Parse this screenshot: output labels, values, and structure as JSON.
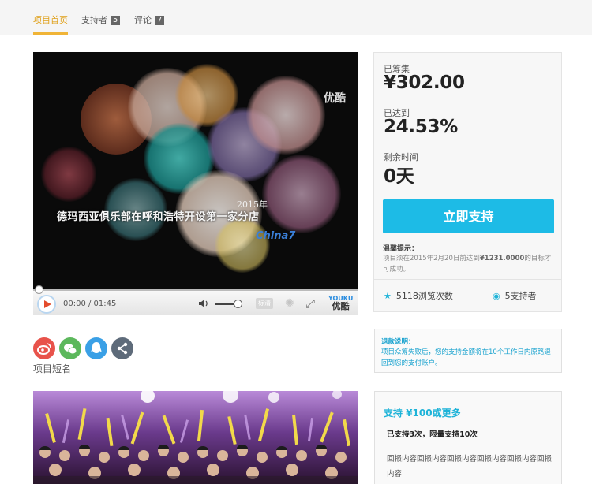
{
  "tabs": [
    {
      "label": "项目首页",
      "active": true
    },
    {
      "label": "支持者",
      "badge": "5"
    },
    {
      "label": "评论",
      "badge": "7"
    }
  ],
  "video": {
    "watermark": "优酷",
    "caption_year": "2015年",
    "caption": "德玛西亚俱乐部在呼和浩特开设第一家分店",
    "channel_logo": "China7",
    "time": "00:00 / 01:45",
    "hd_label": "标清",
    "brand_top": "YOUKU",
    "brand_bottom": "优酷",
    "progress": 0,
    "volume": 0.85
  },
  "share": {
    "icons": [
      "weibo-icon",
      "wechat-icon",
      "qq-icon",
      "share-icon"
    ],
    "colors": {
      "weibo": "#e8534b",
      "wechat": "#5cb85c",
      "qq": "#3aa0e6",
      "share": "#5e6b7a"
    }
  },
  "project": {
    "short_name": "项目短名"
  },
  "funding": {
    "raised_label": "已筹集",
    "raised_value": "¥302.00",
    "reached_label": "已达到",
    "reached_value": "24.53%",
    "remaining_label": "剩余时间",
    "remaining_value": "0天",
    "support_button": "立即支持",
    "tip_title": "温馨提示：",
    "tip_text_pre": "项目须在2015年2月20日前达到",
    "tip_amount": "¥1231.0000",
    "tip_text_post": "的目标才可成功。",
    "views": "5118浏览次数",
    "supporters": "5支持者"
  },
  "refund": {
    "title": "退款说明：",
    "text": "项目众筹失败后，您的支持金额将在10个工作日内原路退回到您的支付账户。"
  },
  "reward": {
    "title": "支持 ¥100或更多",
    "count": "已支持3次，限量支持10次",
    "text": "回报内容回报内容回报内容回报内容回报内容回报内容"
  },
  "colors": {
    "accent": "#1dbbe6",
    "tab_active": "#f0b437"
  }
}
